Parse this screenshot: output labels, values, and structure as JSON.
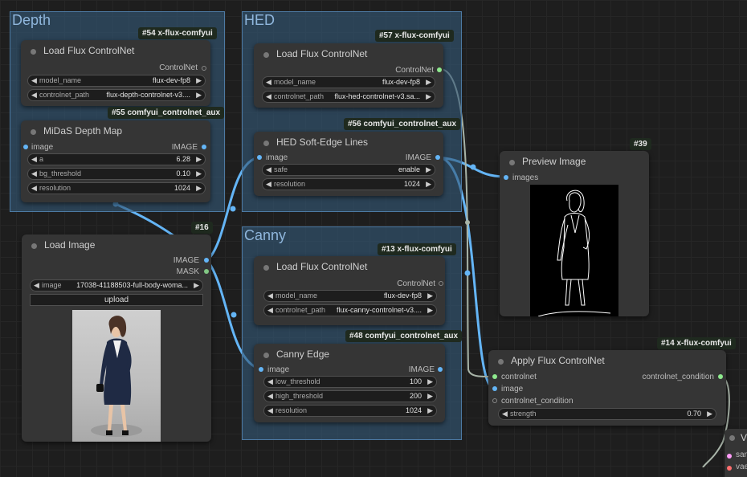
{
  "groups": {
    "depth": "Depth",
    "hed": "HED",
    "canny": "Canny"
  },
  "nodes": {
    "depth_loader": {
      "badge": "#54 x-flux-comfyui",
      "title": "Load Flux ControlNet",
      "output": "ControlNet",
      "model_name_label": "model_name",
      "model_name_value": "flux-dev-fp8",
      "controlnet_path_label": "controlnet_path",
      "controlnet_path_value": "flux-depth-controlnet-v3...."
    },
    "midas": {
      "badge": "#55 comfyui_controlnet_aux",
      "title": "MiDaS Depth Map",
      "input": "image",
      "output": "IMAGE",
      "a_label": "a",
      "a_value": "6.28",
      "bg_label": "bg_threshold",
      "bg_value": "0.10",
      "res_label": "resolution",
      "res_value": "1024"
    },
    "hed_loader": {
      "badge": "#57 x-flux-comfyui",
      "title": "Load Flux ControlNet",
      "output": "ControlNet",
      "model_name_label": "model_name",
      "model_name_value": "flux-dev-fp8",
      "controlnet_path_label": "controlnet_path",
      "controlnet_path_value": "flux-hed-controlnet-v3.sa..."
    },
    "hed": {
      "badge": "#56 comfyui_controlnet_aux",
      "title": "HED Soft-Edge Lines",
      "input": "image",
      "output": "IMAGE",
      "safe_label": "safe",
      "safe_value": "enable",
      "res_label": "resolution",
      "res_value": "1024"
    },
    "load_image": {
      "badge": "#16",
      "title": "Load Image",
      "output_image": "IMAGE",
      "output_mask": "MASK",
      "image_label": "image",
      "image_value": "17038-41188503-full-body-woma...",
      "upload": "upload"
    },
    "canny_loader": {
      "badge": "#13 x-flux-comfyui",
      "title": "Load Flux ControlNet",
      "output": "ControlNet",
      "model_name_label": "model_name",
      "model_name_value": "flux-dev-fp8",
      "controlnet_path_label": "controlnet_path",
      "controlnet_path_value": "flux-canny-controlnet-v3...."
    },
    "canny": {
      "badge": "#48 comfyui_controlnet_aux",
      "title": "Canny Edge",
      "input": "image",
      "output": "IMAGE",
      "low_label": "low_threshold",
      "low_value": "100",
      "high_label": "high_threshold",
      "high_value": "200",
      "res_label": "resolution",
      "res_value": "1024"
    },
    "preview": {
      "badge": "#39",
      "title": "Preview Image",
      "input": "images"
    },
    "apply": {
      "badge": "#14 x-flux-comfyui",
      "title": "Apply Flux ControlNet",
      "input_controlnet": "controlnet",
      "input_image": "image",
      "input_condition": "controlnet_condition",
      "output": "controlnet_condition",
      "strength_label": "strength",
      "strength_value": "0.70"
    },
    "partial": {
      "title": "V",
      "in1": "san",
      "in2": "vae"
    }
  },
  "colors": {
    "image_slot": "#64b5f6",
    "mask_slot": "#81c784",
    "controlnet_slot": "#8eea8e",
    "wire_image": "#64b5f6",
    "wire_controlnet": "#a8b4a8"
  },
  "icons": {
    "arrow_left": "triangle-left",
    "arrow_right": "triangle-right"
  }
}
